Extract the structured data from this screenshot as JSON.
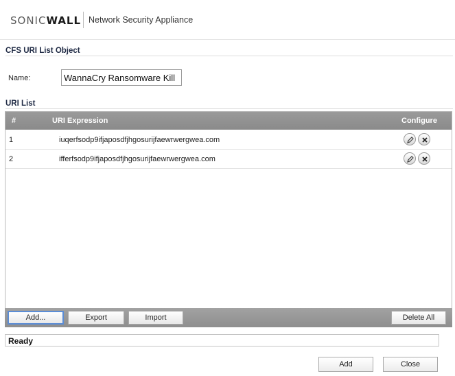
{
  "header": {
    "logo_part1": "SONIC",
    "logo_part2": "WALL",
    "product_name": "Network Security Appliance"
  },
  "object_section": {
    "title": "CFS URI List Object",
    "name_label": "Name:",
    "name_value": "WannaCry Ransomware Kill"
  },
  "uri_section": {
    "title": "URI List",
    "columns": {
      "num": "#",
      "expression": "URI Expression",
      "configure": "Configure"
    },
    "rows": [
      {
        "num": "1",
        "uri": "iuqerfsodp9ifjaposdfjhgosurijfaewrwergwea.com"
      },
      {
        "num": "2",
        "uri": "ifferfsodp9ifjaposdfjhgosurijfaewrwergwea.com"
      }
    ],
    "toolbar": {
      "add": "Add...",
      "export": "Export",
      "import": "Import",
      "delete_all": "Delete All"
    }
  },
  "status": "Ready",
  "footer": {
    "add": "Add",
    "close": "Close"
  },
  "icons": {
    "edit": "pencil-icon",
    "delete": "delete-x-icon"
  }
}
